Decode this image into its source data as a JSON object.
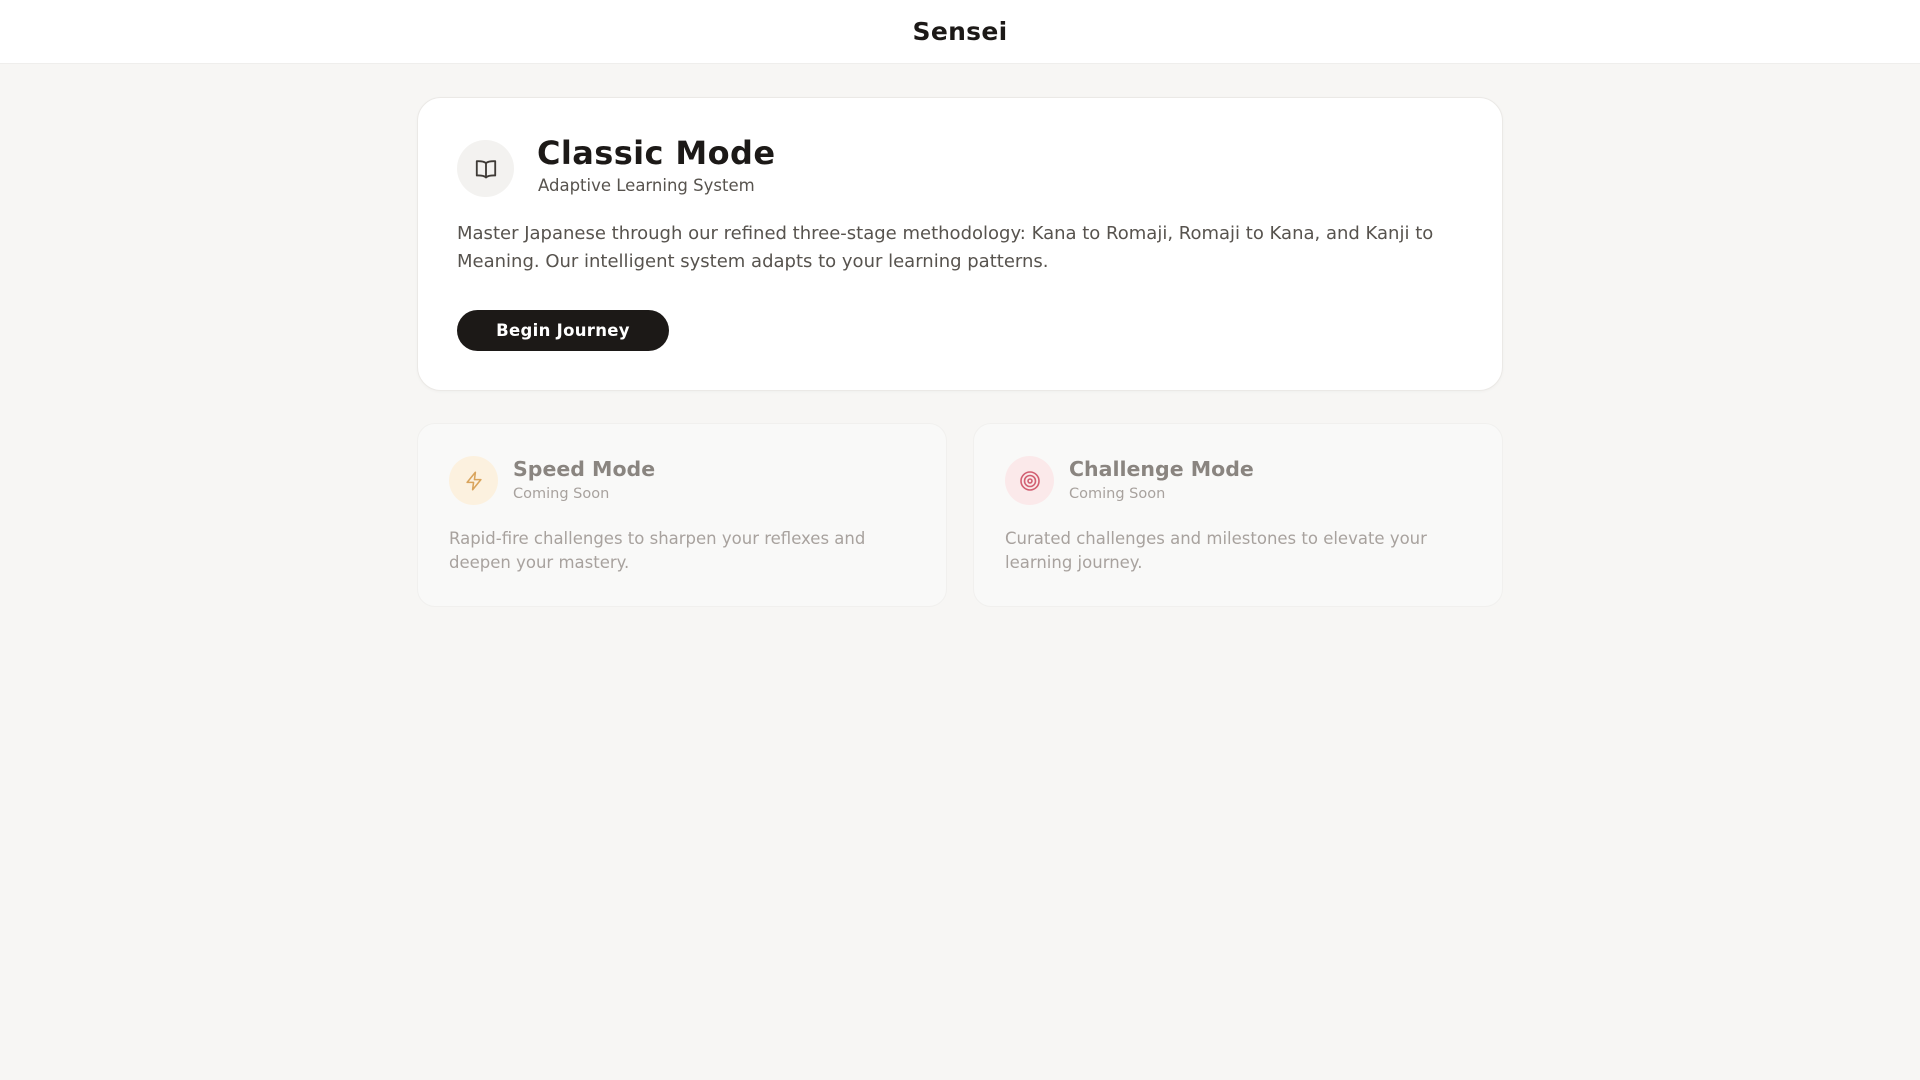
{
  "app": {
    "title": "Sensei"
  },
  "classic_mode": {
    "title": "Classic Mode",
    "subtitle": "Adaptive Learning System",
    "description": "Master Japanese through our refined three-stage methodology: Kana to Romaji, Romaji to Kana, and Kanji to Meaning. Our intelligent system adapts to your learning patterns.",
    "button_label": "Begin Journey",
    "icon": "book-open-icon"
  },
  "speed_mode": {
    "title": "Speed Mode",
    "status": "Coming Soon",
    "description": "Rapid-fire challenges to sharpen your reflexes and deepen your mastery.",
    "icon": "lightning-icon",
    "accent_color": "#d9a45c"
  },
  "challenge_mode": {
    "title": "Challenge Mode",
    "status": "Coming Soon",
    "description": "Curated challenges and milestones to elevate your learning journey.",
    "icon": "target-icon",
    "accent_color": "#d25f72"
  },
  "colors": {
    "background": "#f7f6f4",
    "primary_button": "#1c1917",
    "text_primary": "#1c1917",
    "text_secondary": "#57534e",
    "text_muted": "#a8a29e"
  }
}
